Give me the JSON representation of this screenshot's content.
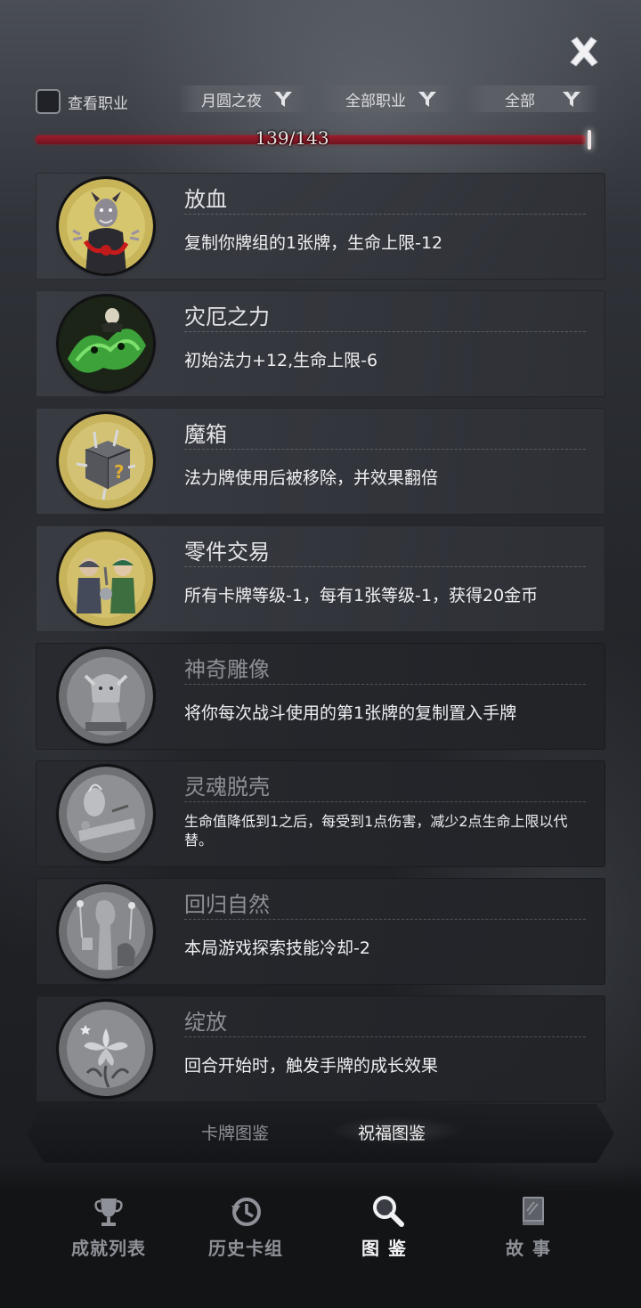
{
  "header": {
    "show_class_label": "查看职业",
    "filters": [
      {
        "label": "月圆之夜"
      },
      {
        "label": "全部职业"
      },
      {
        "label": "全部"
      }
    ],
    "progress_text": "139/143",
    "progress_fraction": 0.972
  },
  "blessings": [
    {
      "title": "放血",
      "desc": "复制你牌组的1张牌，生命上限-12",
      "unlocked": true
    },
    {
      "title": "灾厄之力",
      "desc": "初始法力+12,生命上限-6",
      "unlocked": true
    },
    {
      "title": "魔箱",
      "desc": "法力牌使用后被移除，并效果翻倍",
      "unlocked": true
    },
    {
      "title": "零件交易",
      "desc": "所有卡牌等级-1，每有1张等级-1，获得20金币",
      "unlocked": true
    },
    {
      "title": "神奇雕像",
      "desc": "将你每次战斗使用的第1张牌的复制置入手牌",
      "unlocked": false
    },
    {
      "title": "灵魂脱壳",
      "desc": "生命值降低到1之后，每受到1点伤害，减少2点生命上限以代替。",
      "unlocked": false
    },
    {
      "title": "回归自然",
      "desc": "本局游戏探索技能冷却-2",
      "unlocked": false
    },
    {
      "title": "绽放",
      "desc": "回合开始时，触发手牌的成长效果",
      "unlocked": false
    }
  ],
  "tabs": {
    "cards": "卡牌图鉴",
    "blessings": "祝福图鉴",
    "active": "blessings"
  },
  "nav": {
    "achievements": "成就列表",
    "history": "历史卡组",
    "codex": "图鉴",
    "story": "故事",
    "active": "codex"
  },
  "colors": {
    "progress_red": "#9b1e2b",
    "background": "#24262b"
  }
}
